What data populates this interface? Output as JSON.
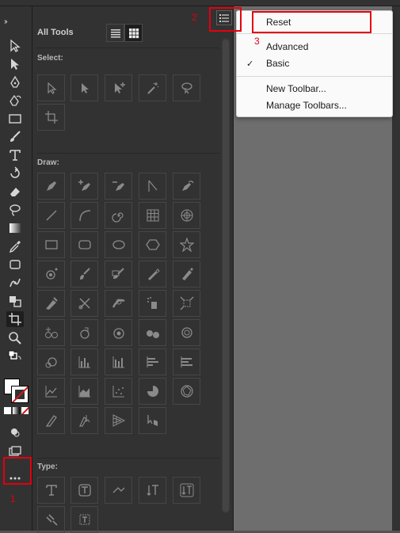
{
  "window": {
    "collapse_glyph": "››"
  },
  "panel": {
    "title": "All Tools",
    "view_list_icon": "list-view-icon",
    "view_grid_icon": "grid-view-icon",
    "menu_icon": "panel-menu-icon"
  },
  "sections": {
    "select": "Select:",
    "draw": "Draw:",
    "type": "Type:"
  },
  "menu": {
    "reset": "Reset",
    "advanced": "Advanced",
    "basic": "Basic",
    "basic_checked": true,
    "check_glyph": "✓",
    "new_toolbar": "New Toolbar...",
    "manage_toolbars": "Manage Toolbars..."
  },
  "annotations": {
    "n1": "1",
    "n2": "2",
    "n3": "3",
    "color": "#e3000f"
  },
  "left_tools": [
    "selection-icon",
    "direct-selection-icon",
    "pen-icon",
    "curvature-icon",
    "rectangle-icon",
    "paintbrush-icon",
    "type-icon",
    "rotate-icon",
    "eraser-icon",
    "lasso-icon",
    "gradient-icon",
    "eyedropper-icon",
    "artboard-icon",
    "puppet-warp-icon",
    "shape-builder-icon",
    "crop-icon",
    "zoom-icon",
    "swap-fill-stroke-icon",
    "fill-stroke-icon",
    "color-mode-icon",
    "draw-mode-icon",
    "screen-mode-icon",
    "more-tools-icon"
  ]
}
